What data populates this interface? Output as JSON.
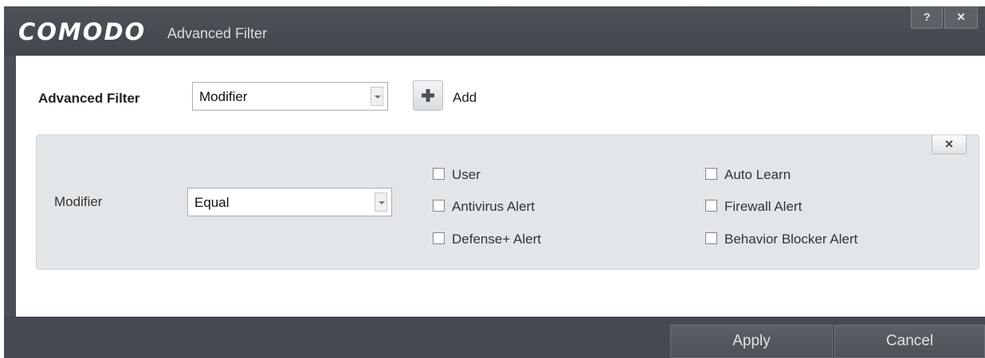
{
  "window": {
    "brand": "COMODO",
    "title": "Advanced Filter",
    "help_label": "?",
    "close_label": "✕",
    "help_icon": "help-icon",
    "close_icon": "close-icon"
  },
  "filter": {
    "label": "Advanced Filter",
    "selected": "Modifier",
    "add_label": "Add",
    "add_icon": "plus-icon",
    "accent": "#4a5259"
  },
  "condition": {
    "label": "Modifier",
    "operator": "Equal",
    "remove_label": "✕",
    "options": [
      {
        "label": "User",
        "checked": false
      },
      {
        "label": "Antivirus Alert",
        "checked": false
      },
      {
        "label": "Defense+ Alert",
        "checked": false
      },
      {
        "label": "Auto Learn",
        "checked": false
      },
      {
        "label": "Firewall Alert",
        "checked": false
      },
      {
        "label": "Behavior Blocker Alert",
        "checked": false
      }
    ]
  },
  "footer": {
    "apply_label": "Apply",
    "cancel_label": "Cancel"
  }
}
